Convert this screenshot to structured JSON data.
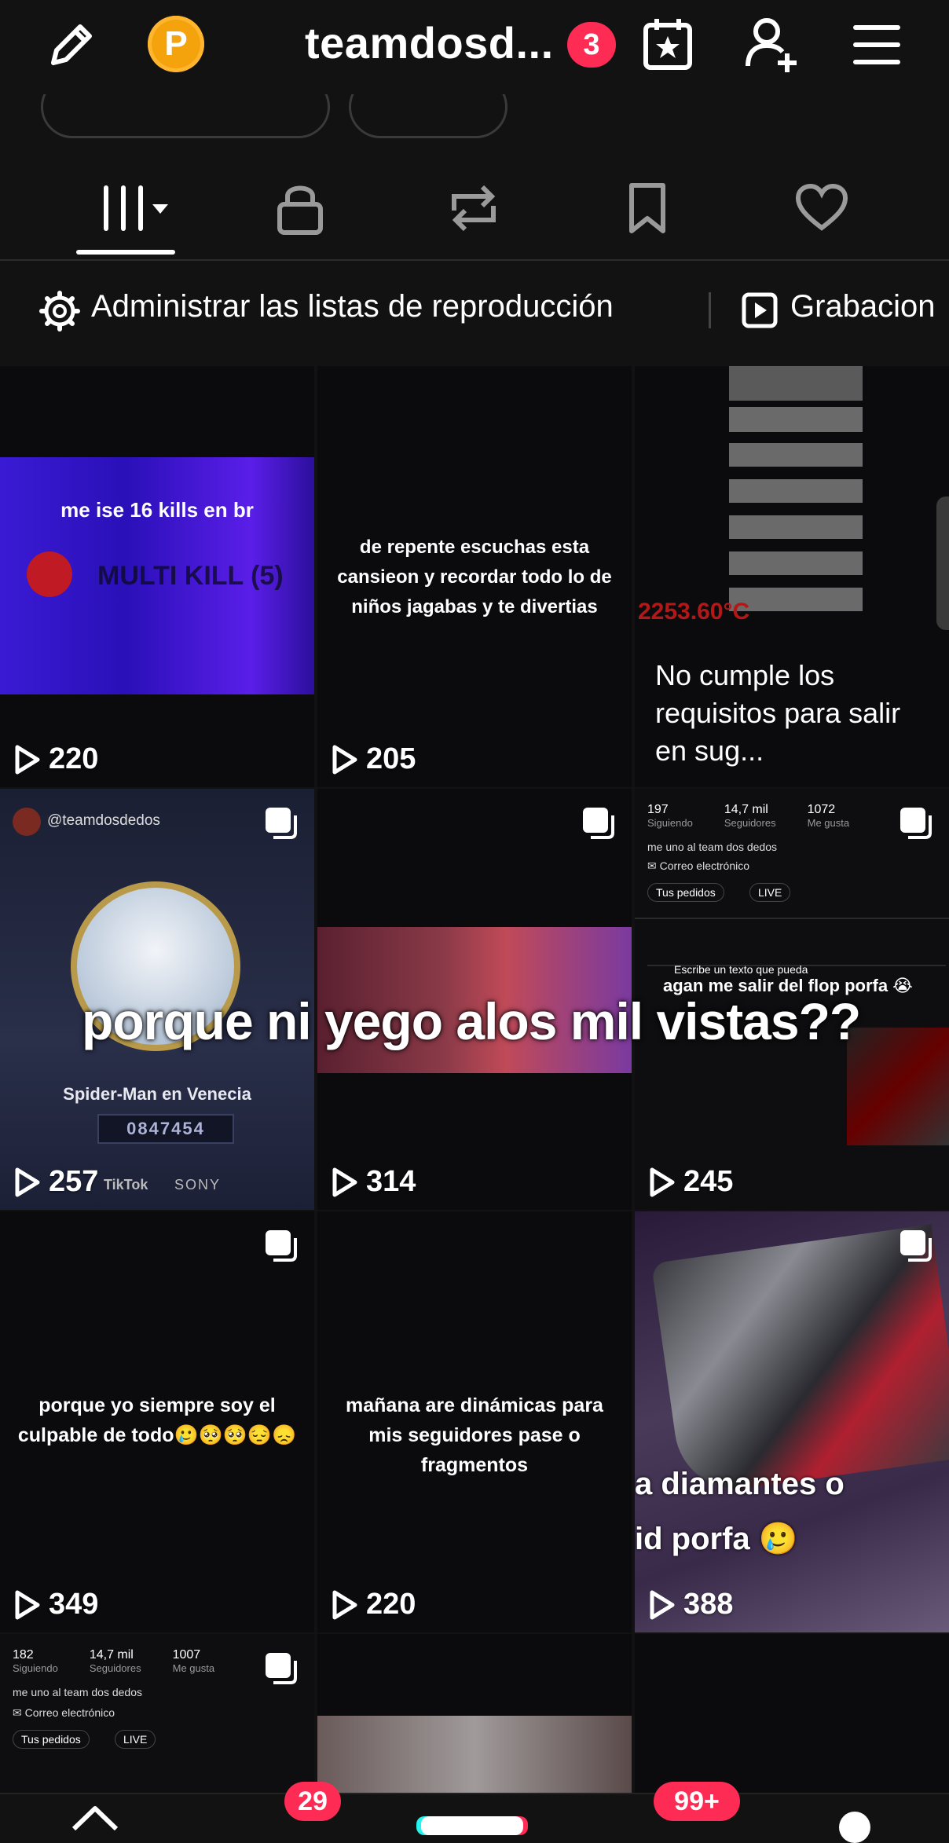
{
  "header": {
    "username": "teamdosd...",
    "notif_count": "3",
    "coin_letter": "P",
    "icons": [
      "pencil-icon",
      "calendar-star-icon",
      "add-user-icon",
      "menu-icon"
    ]
  },
  "tabs": [
    "videos-grid",
    "private",
    "reposts",
    "saved",
    "liked"
  ],
  "toolbar": {
    "manage_label": "Administrar las listas de reproducción",
    "recordings_label": "Grabacion"
  },
  "overlay_caption": "porque ni yego alos mil vistas??",
  "videos": [
    {
      "views": "220",
      "top_text": "me ise 16 kills en br",
      "brand_text": "MULTI KILL (5)"
    },
    {
      "views": "205",
      "caption": "de repente escuchas esta cansieon y recordar todo lo de niños jagabas y te divertias"
    },
    {
      "views": "",
      "temp_text": "2253.60°C",
      "caption": "No cumple los requisitos para salir en sug..."
    },
    {
      "views": "257",
      "handle": "@teamdosdedos",
      "title": "Spider-Man en Venecia",
      "code": "0847454",
      "brand_tiktok": "TikTok",
      "brand_sony": "SONY"
    },
    {
      "views": "314"
    },
    {
      "views": "245",
      "stats": [
        {
          "num": "197",
          "label": "Siguiendo"
        },
        {
          "num": "14,7 mil",
          "label": "Seguidores"
        },
        {
          "num": "1072",
          "label": "Me gusta"
        }
      ],
      "bio": "me uno al team dos dedos",
      "email": "Correo electrónico",
      "pill1": "Tus pedidos",
      "pill2": "LIVE",
      "inner_text": "Escribe un texto que pueda",
      "inner_caption": "agan me salir del flop porfa 😭"
    },
    {
      "views": "349",
      "caption": "porque yo siempre soy el culpable de todo🥲🥺🥺😔😞"
    },
    {
      "views": "220",
      "caption": "mañana are dinámicas para mis seguidores pase o fragmentos"
    },
    {
      "views": "388",
      "caption": "a diamantes o id porfa 🥲"
    },
    {
      "stats": [
        {
          "num": "182",
          "label": "Siguiendo"
        },
        {
          "num": "14,7 mil",
          "label": "Seguidores"
        },
        {
          "num": "1007",
          "label": "Me gusta"
        }
      ],
      "bio": "me uno al team dos dedos",
      "email": "Correo electrónico",
      "pill1": "Tus pedidos",
      "pill2": "LIVE"
    }
  ],
  "bottom_badges": {
    "inbox": "29",
    "messages": "99+"
  }
}
